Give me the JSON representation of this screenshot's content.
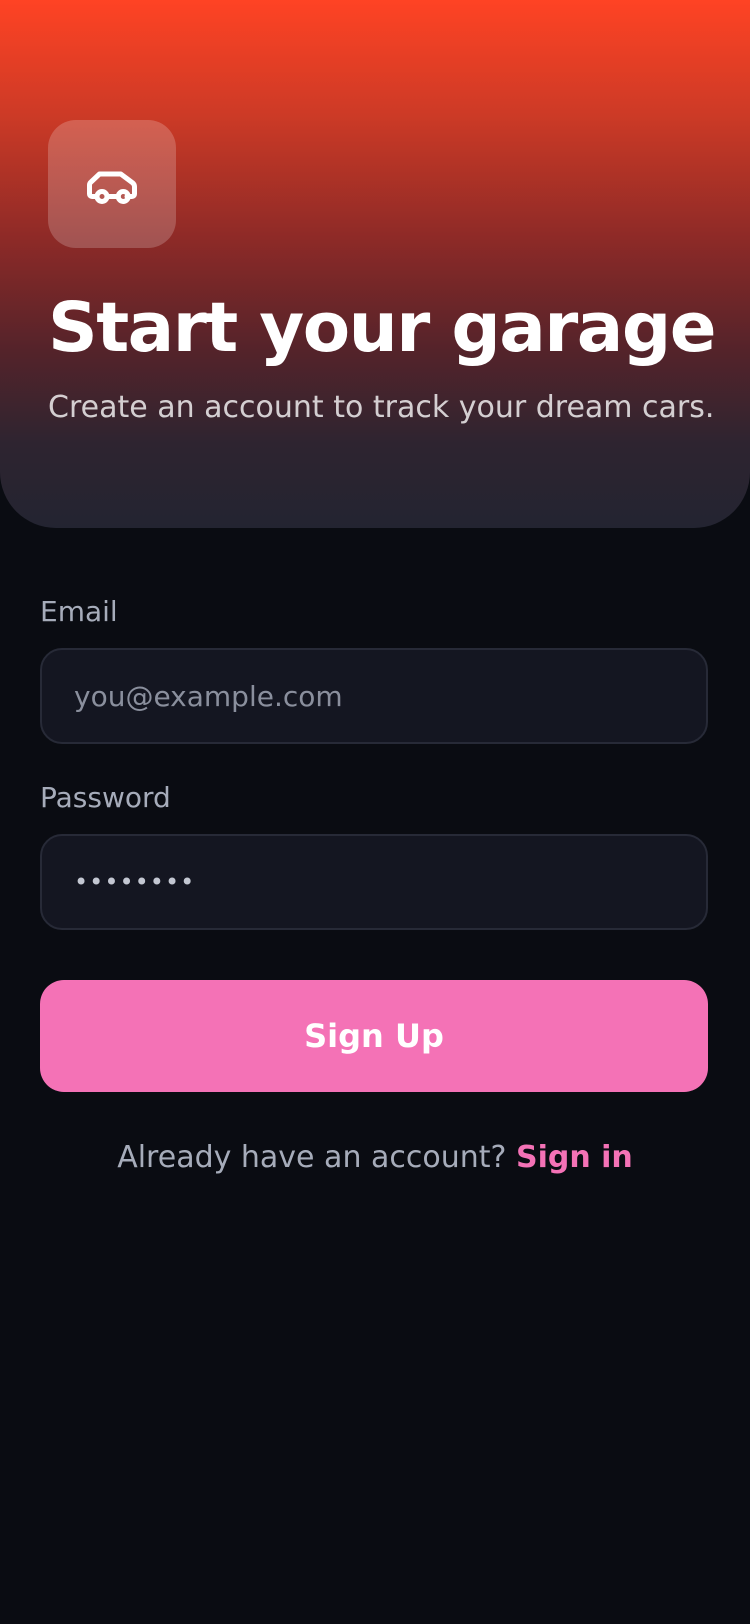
{
  "hero": {
    "title": "Start your garage",
    "subtitle": "Create an account to track your dream cars.",
    "logo_icon": "car-icon"
  },
  "form": {
    "email": {
      "label": "Email",
      "placeholder": "you@example.com",
      "value": ""
    },
    "password": {
      "label": "Password",
      "value": "••••••••"
    },
    "submit_label": "Sign Up"
  },
  "footer": {
    "prompt": "Already have an account?",
    "link_label": "Sign in"
  },
  "colors": {
    "accent": "#f472b6",
    "background": "#0a0c12",
    "hero_top": "#ff4324",
    "hero_bottom": "#232431",
    "field_background": "#141621"
  }
}
